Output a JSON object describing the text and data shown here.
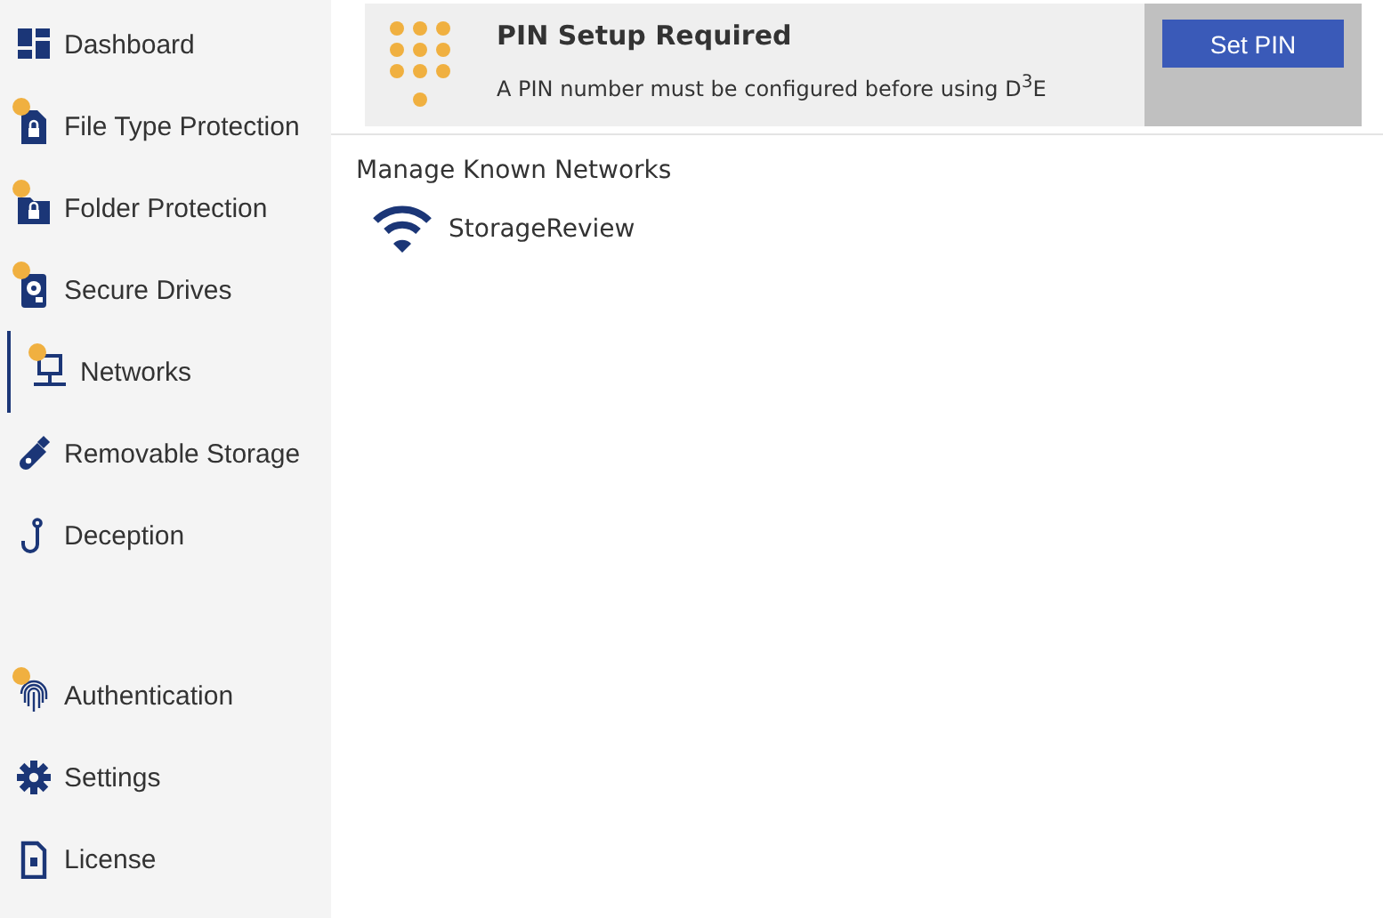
{
  "sidebar": {
    "top_items": [
      {
        "label": "Dashboard",
        "kind": "dashboard",
        "warning": false,
        "selected": false
      },
      {
        "label": "File Type Protection",
        "kind": "filelock",
        "warning": true,
        "selected": false
      },
      {
        "label": "Folder Protection",
        "kind": "folderlock",
        "warning": true,
        "selected": false
      },
      {
        "label": "Secure Drives",
        "kind": "drive",
        "warning": true,
        "selected": false
      },
      {
        "label": "Networks",
        "kind": "network",
        "warning": true,
        "selected": true
      },
      {
        "label": "Removable Storage",
        "kind": "usb",
        "warning": false,
        "selected": false
      },
      {
        "label": "Deception",
        "kind": "hook",
        "warning": false,
        "selected": false
      }
    ],
    "bottom_items": [
      {
        "label": "Authentication",
        "kind": "fingerprint",
        "warning": true,
        "selected": false
      },
      {
        "label": "Settings",
        "kind": "gear",
        "warning": false,
        "selected": false
      },
      {
        "label": "License",
        "kind": "license",
        "warning": false,
        "selected": false
      }
    ]
  },
  "banner": {
    "title": "PIN Setup Required",
    "message": "A PIN number must be configured before using D$^{3}$E",
    "button": "Set PIN"
  },
  "networks": {
    "heading": "Manage Known Networks",
    "items": [
      {
        "name": "StorageReview"
      }
    ]
  }
}
